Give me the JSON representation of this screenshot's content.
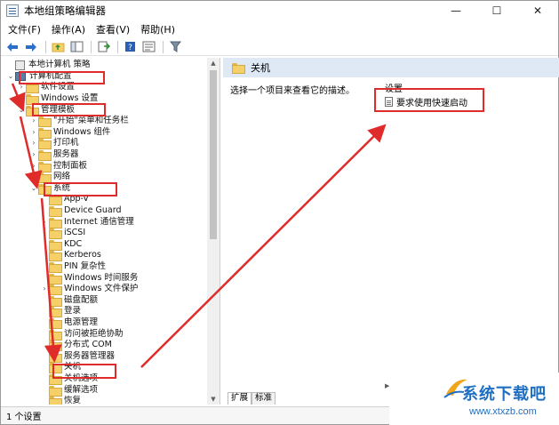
{
  "window": {
    "title": "本地组策略编辑器",
    "controls": [
      "—",
      "☐",
      "✕"
    ]
  },
  "menu": [
    "文件(F)",
    "操作(A)",
    "查看(V)",
    "帮助(H)"
  ],
  "toolbar": [
    "back-arrow-icon",
    "forward-arrow-icon",
    "up-folder-icon",
    "show-hide-tree-icon",
    "export-list-icon",
    "help-icon",
    "properties-icon",
    "filter-icon"
  ],
  "tree": {
    "root": "本地计算机 策略",
    "computer_config": "计算机配置",
    "software_settings": "软件设置",
    "windows_settings": "Windows 设置",
    "admin_templates": "管理模板",
    "items": [
      "\"开始\"菜单和任务栏",
      "Windows 组件",
      "打印机",
      "服务器",
      "控制面板",
      "网络"
    ],
    "system": "系统",
    "system_children": [
      "App-V",
      "Device Guard",
      "Internet 通信管理",
      "iSCSI",
      "KDC",
      "Kerberos",
      "PIN 复杂性",
      "Windows 时间服务",
      "Windows 文件保护",
      "磁盘配额",
      "登录",
      "电源管理",
      "访问被拒绝协助",
      "分布式 COM",
      "服务器管理器",
      "关机",
      "关机选项",
      "缓解选项",
      "恢复"
    ]
  },
  "right": {
    "header": "关机",
    "description": "选择一个项目来查看它的描述。",
    "column_header": "设置",
    "setting": "要求使用快速启动"
  },
  "tabs": [
    "扩展",
    "标准"
  ],
  "status": "1 个设置",
  "annotation_color": "#e02b2b",
  "watermark": {
    "brand": "系统下载吧",
    "url": "www.xtxzb.com"
  }
}
